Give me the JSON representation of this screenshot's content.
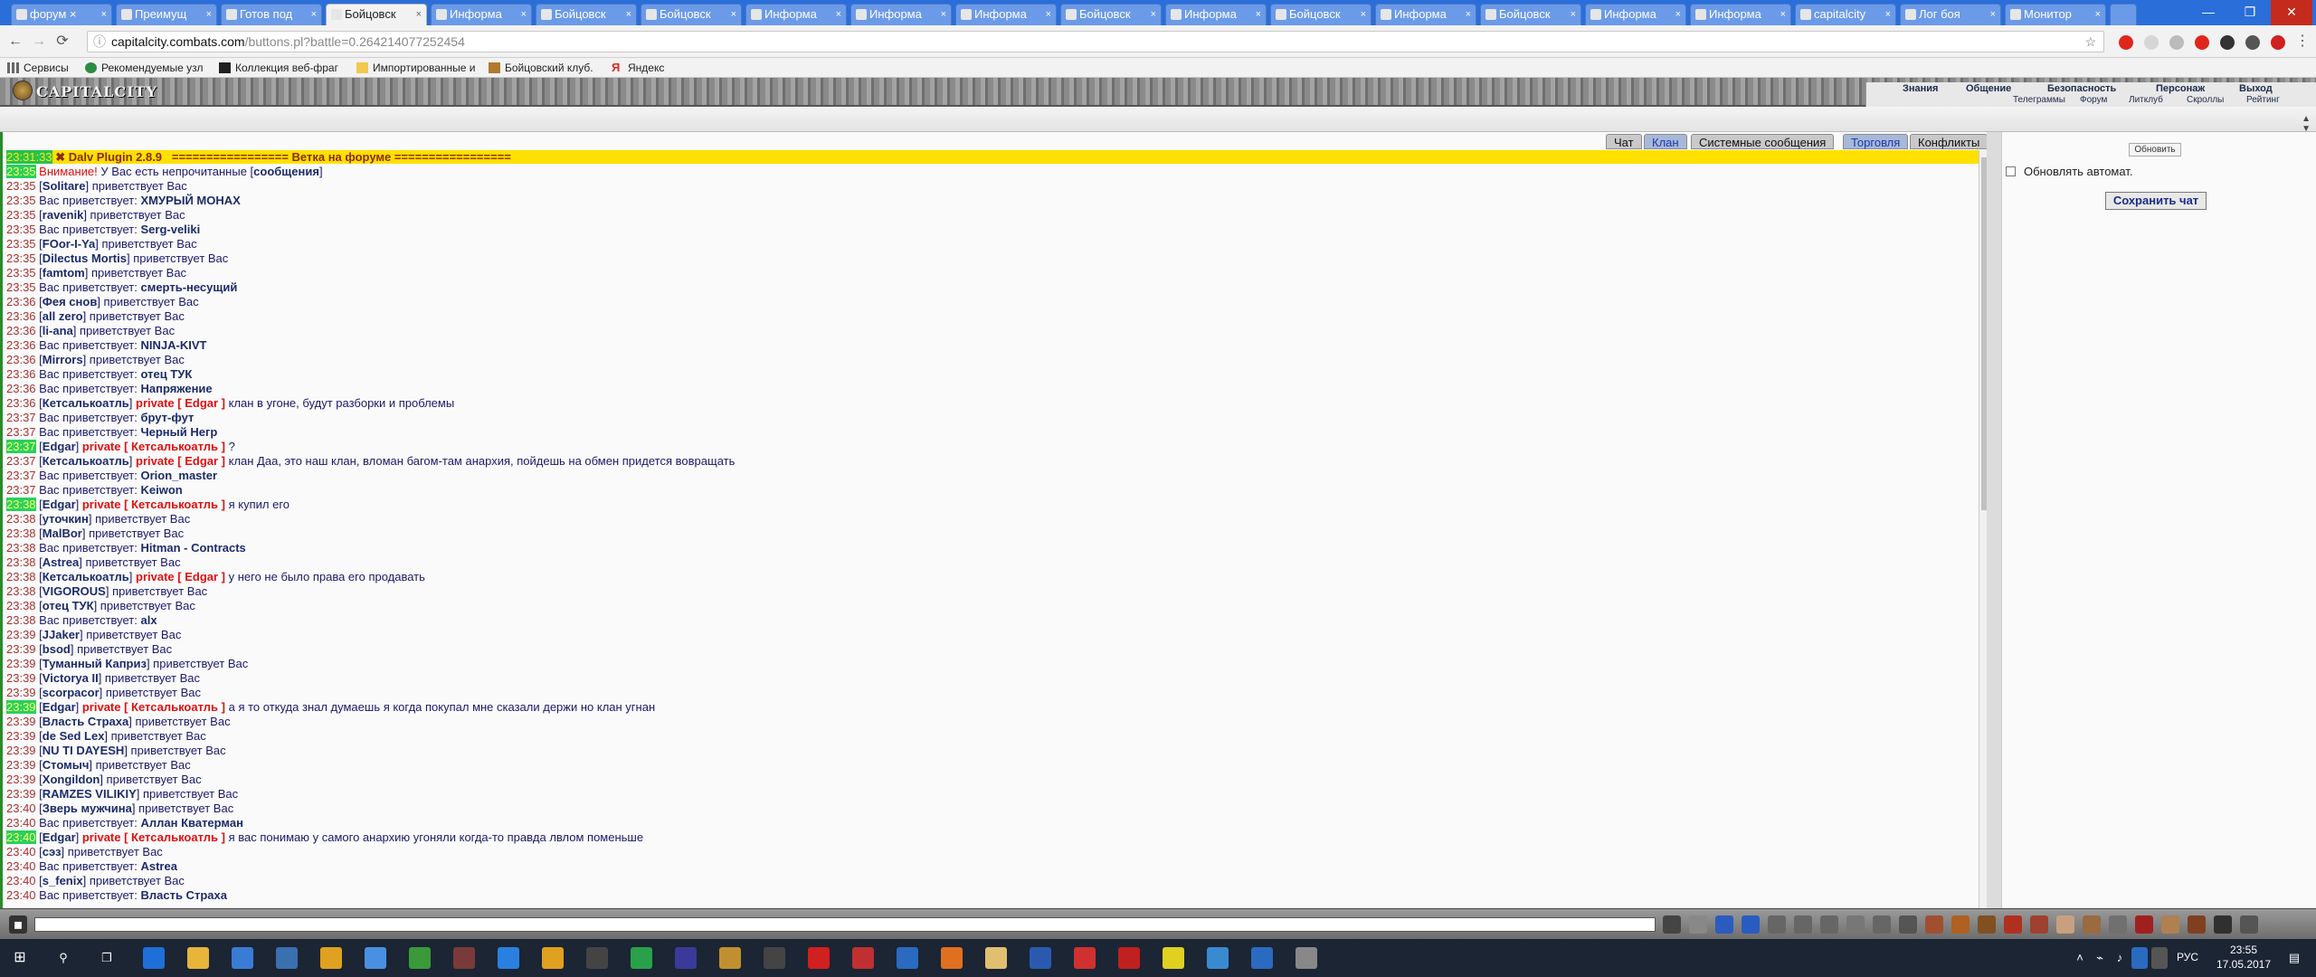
{
  "browser": {
    "tabs": [
      {
        "label": "форум ×",
        "active": false
      },
      {
        "label": "Преимущ",
        "active": false
      },
      {
        "label": "Готов под",
        "active": false
      },
      {
        "label": "Бойцовск",
        "active": true
      },
      {
        "label": "Информа",
        "active": false
      },
      {
        "label": "Бойцовск",
        "active": false
      },
      {
        "label": "Бойцовск",
        "active": false
      },
      {
        "label": "Информа",
        "active": false
      },
      {
        "label": "Информа",
        "active": false
      },
      {
        "label": "Информа",
        "active": false
      },
      {
        "label": "Бойцовск",
        "active": false
      },
      {
        "label": "Информа",
        "active": false
      },
      {
        "label": "Бойцовск",
        "active": false
      },
      {
        "label": "Информа",
        "active": false
      },
      {
        "label": "Бойцовск",
        "active": false
      },
      {
        "label": "Информа",
        "active": false
      },
      {
        "label": "Информа",
        "active": false
      },
      {
        "label": "capitalcity",
        "active": false
      },
      {
        "label": "Лог боя",
        "active": false
      },
      {
        "label": "Монитор",
        "active": false
      }
    ],
    "url_host": "capitalcity.combats.com",
    "url_path": "/buttons.pl?battle=0.264214077252454",
    "bookmarks": [
      "Сервисы",
      "Рекомендуемые узл",
      "Коллекция веб-фраг",
      "Импортированные и",
      "Бойцовский клуб.",
      "Яндекс"
    ]
  },
  "game": {
    "logo": "CAPITALCITY",
    "menu_top": [
      "Знания",
      "Общение",
      "Безопасность",
      "Персонаж",
      "Выход"
    ],
    "menu_sub": [
      "Телеграммы",
      "Форум",
      "Литклуб",
      "Скроллы",
      "Рейтинг"
    ]
  },
  "chat": {
    "tabs": [
      "Чат",
      "Клан",
      "Системные сообщения",
      "Торговля",
      "Конфликты"
    ],
    "plugin_ts": "23:31:33",
    "plugin_text": " ✖ Dalv Plugin 2.8.9   ================= Ветка на форуме =================",
    "lines": [
      {
        "ts": "23:35",
        "hl": true,
        "pre": " ",
        "warn": "Внимание!",
        "text": " У Вас есть непрочитанные [",
        "nick": "сообщения",
        "post": "]"
      },
      {
        "ts": "23:35",
        "pre": " [",
        "nick": "Solitare",
        "text": "] приветствует Вас"
      },
      {
        "ts": "23:35",
        "pre": " Вас приветствует: ",
        "nick": "ХМУРЫЙ МОНАХ",
        "text": ""
      },
      {
        "ts": "23:35",
        "pre": " [",
        "nick": "ravenik",
        "text": "] приветствует Вас"
      },
      {
        "ts": "23:35",
        "pre": " Вас приветствует: ",
        "nick": "Serg-veliki",
        "text": ""
      },
      {
        "ts": "23:35",
        "pre": " [",
        "nick": "FOor-I-Ya",
        "text": "] приветствует Вас"
      },
      {
        "ts": "23:35",
        "pre": " [",
        "nick": "Dilectus Mortis",
        "text": "] приветствует Вас"
      },
      {
        "ts": "23:35",
        "pre": " [",
        "nick": "famtom",
        "text": "] приветствует Вас"
      },
      {
        "ts": "23:35",
        "pre": " Вас приветствует: ",
        "nick": "смерть-несущий",
        "text": ""
      },
      {
        "ts": "23:36",
        "pre": " [",
        "nick": "Фея снов",
        "text": "] приветствует Вас"
      },
      {
        "ts": "23:36",
        "pre": " [",
        "nick": "all zero",
        "text": "] приветствует Вас"
      },
      {
        "ts": "23:36",
        "pre": " [",
        "nick": "li-ana",
        "text": "] приветствует Вас"
      },
      {
        "ts": "23:36",
        "pre": " Вас приветствует: ",
        "nick": "NINJA-KIVT",
        "text": ""
      },
      {
        "ts": "23:36",
        "pre": " [",
        "nick": "Mirrors",
        "text": "] приветствует Вас"
      },
      {
        "ts": "23:36",
        "pre": " Вас приветствует: ",
        "nick": "отец ТУК",
        "text": ""
      },
      {
        "ts": "23:36",
        "pre": " Вас приветствует: ",
        "nick": "Напряжение",
        "text": ""
      },
      {
        "ts": "23:36",
        "pre": " [",
        "nick": "Кетсалькоатль",
        "text": "] ",
        "pv": "private [ Edgar ]",
        "post": " клан в угоне, будут разборки и проблемы"
      },
      {
        "ts": "23:37",
        "pre": " Вас приветствует: ",
        "nick": "брут-фут",
        "text": ""
      },
      {
        "ts": "23:37",
        "pre": " Вас приветствует: ",
        "nick": "Черный Негр",
        "text": ""
      },
      {
        "ts": "23:37",
        "hl": true,
        "pre": " [",
        "nick": "Edgar",
        "text": "] ",
        "pv": "private [ Кетсалькоатль ]",
        "post": " ?"
      },
      {
        "ts": "23:37",
        "pre": " [",
        "nick": "Кетсалькоатль",
        "text": "] ",
        "pv": "private [ Edgar ]",
        "post": " клан Даа, это наш клан, вломан багом-там анархия, пойдешь на обмен придется вовращать"
      },
      {
        "ts": "23:37",
        "pre": " Вас приветствует: ",
        "nick": "Orion_master",
        "text": ""
      },
      {
        "ts": "23:37",
        "pre": " Вас приветствует: ",
        "nick": "Keiwon",
        "text": ""
      },
      {
        "ts": "23:38",
        "hl": true,
        "pre": " [",
        "nick": "Edgar",
        "text": "] ",
        "pv": "private [ Кетсалькоатль ]",
        "post": " я купил его"
      },
      {
        "ts": "23:38",
        "pre": " [",
        "nick": "уточкин",
        "text": "] приветствует Вас"
      },
      {
        "ts": "23:38",
        "pre": " [",
        "nick": "MalBor",
        "text": "] приветствует Вас"
      },
      {
        "ts": "23:38",
        "pre": " Вас приветствует: ",
        "nick": "Hitman - Contracts",
        "text": ""
      },
      {
        "ts": "23:38",
        "pre": " [",
        "nick": "Astrea",
        "text": "] приветствует Вас"
      },
      {
        "ts": "23:38",
        "pre": " [",
        "nick": "Кетсалькоатль",
        "text": "] ",
        "pv": "private [ Edgar ]",
        "post": " у него не было права его продавать"
      },
      {
        "ts": "23:38",
        "pre": " [",
        "nick": "VIGOROUS",
        "text": "] приветствует Вас"
      },
      {
        "ts": "23:38",
        "pre": " [",
        "nick": "отец ТУК",
        "text": "] приветствует Вас"
      },
      {
        "ts": "23:38",
        "pre": " Вас приветствует: ",
        "nick": "alx",
        "text": ""
      },
      {
        "ts": "23:39",
        "pre": " [",
        "nick": "JJaker",
        "text": "] приветствует Вас"
      },
      {
        "ts": "23:39",
        "pre": " [",
        "nick": "bsod",
        "text": "] приветствует Вас"
      },
      {
        "ts": "23:39",
        "pre": " [",
        "nick": "Туманный Каприз",
        "text": "] приветствует Вас"
      },
      {
        "ts": "23:39",
        "pre": " [",
        "nick": "Victorya II",
        "text": "] приветствует Вас"
      },
      {
        "ts": "23:39",
        "pre": " [",
        "nick": "scorpacor",
        "text": "] приветствует Вас"
      },
      {
        "ts": "23:39",
        "hl": true,
        "pre": " [",
        "nick": "Edgar",
        "text": "] ",
        "pv": "private [ Кетсалькоатль ]",
        "post": " а я то откуда знал думаешь я когда покупал мне сказали держи но клан угнан"
      },
      {
        "ts": "23:39",
        "pre": " [",
        "nick": "Власть Страха",
        "text": "] приветствует Вас"
      },
      {
        "ts": "23:39",
        "pre": " [",
        "nick": "de Sed Lex",
        "text": "] приветствует Вас"
      },
      {
        "ts": "23:39",
        "pre": " [",
        "nick": "NU TI DAYESH",
        "text": "] приветствует Вас"
      },
      {
        "ts": "23:39",
        "pre": " [",
        "nick": "Стомыч",
        "text": "] приветствует Вас"
      },
      {
        "ts": "23:39",
        "pre": " [",
        "nick": "Xongildon",
        "text": "] приветствует Вас"
      },
      {
        "ts": "23:39",
        "pre": " [",
        "nick": "RAMZES VILIKIY",
        "text": "] приветствует Вас"
      },
      {
        "ts": "23:40",
        "pre": " [",
        "nick": "Зверь мужчина",
        "text": "] приветствует Вас"
      },
      {
        "ts": "23:40",
        "pre": " Вас приветствует: ",
        "nick": "Аллан Кватерман",
        "text": ""
      },
      {
        "ts": "23:40",
        "hl": true,
        "pre": " [",
        "nick": "Edgar",
        "text": "] ",
        "pv": "private [ Кетсалькоатль ]",
        "post": " я вас понимаю у самого анархию угоняли когда-то правда лвлом поменьше"
      },
      {
        "ts": "23:40",
        "pre": " [",
        "nick": "сэз",
        "text": "] приветствует Вас"
      },
      {
        "ts": "23:40",
        "pre": " Вас приветствует: ",
        "nick": "Astrea",
        "text": ""
      },
      {
        "ts": "23:40",
        "pre": " [",
        "nick": "s_fenix",
        "text": "] приветствует Вас"
      },
      {
        "ts": "23:40",
        "pre": " Вас приветствует: ",
        "nick": "Власть Страха",
        "text": ""
      }
    ]
  },
  "side": {
    "refresh_label": "Обновить",
    "auto_label": "Обновлять автомат.",
    "save_label": "Сохранить чат"
  },
  "taskbar": {
    "lang": "РУС",
    "time": "23:55",
    "date": "17.05.2017"
  }
}
